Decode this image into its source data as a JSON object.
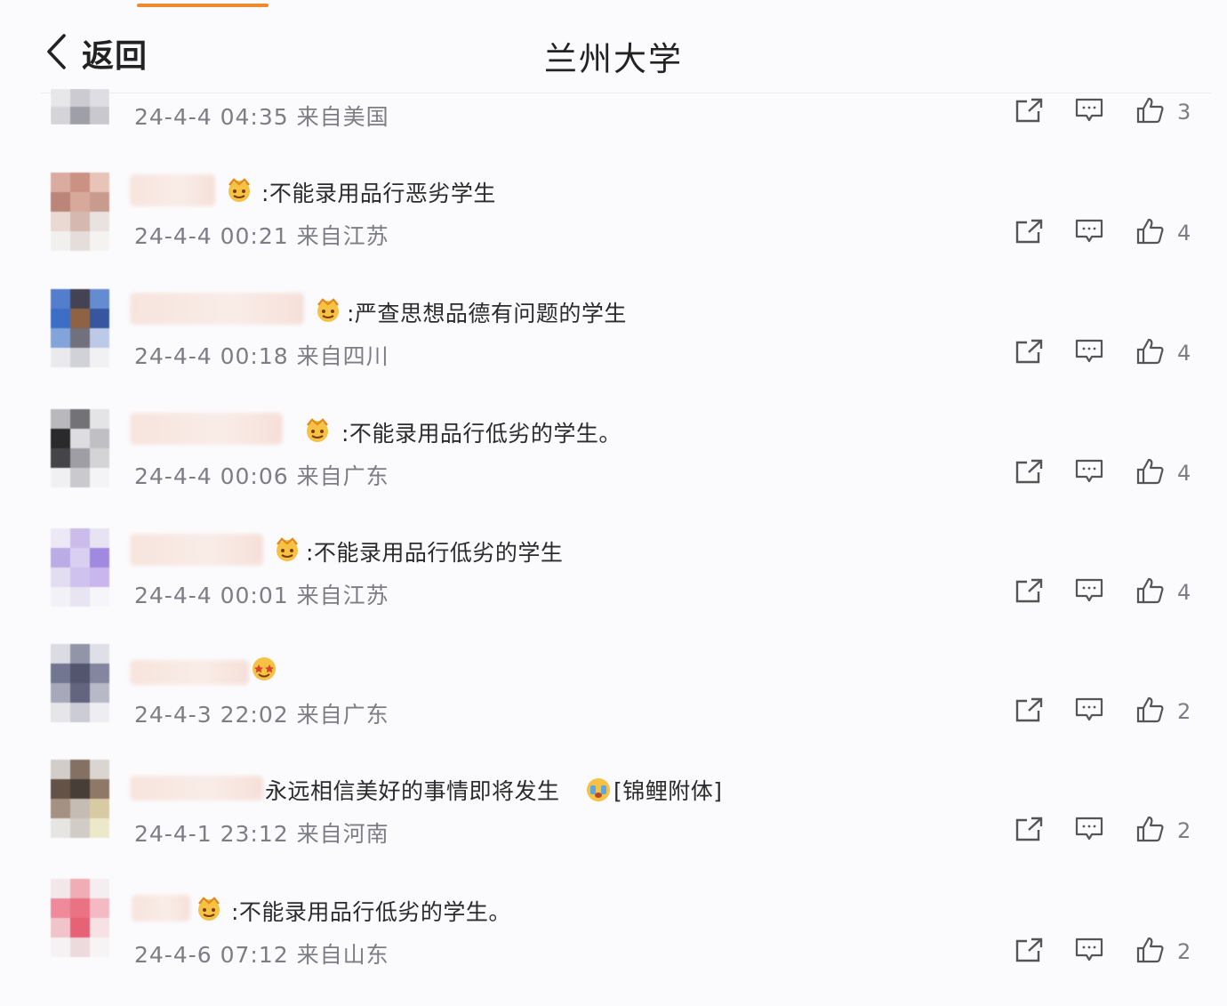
{
  "header": {
    "back_label": "返回",
    "title": "兰州大学"
  },
  "colors": {
    "accent": "#f08a2e",
    "meta_text": "#7d7d85"
  },
  "icons": {
    "back": "chevron-left-icon",
    "share": "share-icon",
    "comment": "comment-icon",
    "like": "thumbs-up-icon",
    "badge": "crown-emoji-icon"
  },
  "comments": [
    {
      "text": "",
      "meta": "24-4-4 04:35 来自美国",
      "likes": "3"
    },
    {
      "text": ":不能录用品行恶劣学生",
      "meta": "24-4-4 00:21 来自江苏",
      "likes": "4"
    },
    {
      "text": ":严查思想品德有问题的学生",
      "meta": "24-4-4 00:18 来自四川",
      "likes": "4"
    },
    {
      "text": ":不能录用品行低劣的学生。",
      "meta": "24-4-4 00:06 来自广东",
      "likes": "4"
    },
    {
      "text": ":不能录用品行低劣的学生",
      "meta": "24-4-4 00:01 来自江苏",
      "likes": "4"
    },
    {
      "text": "",
      "meta": "24-4-3 22:02 来自广东",
      "likes": "2"
    },
    {
      "text": "永远相信美好的事情即将发生",
      "text_suffix": "[锦鲤附体]",
      "meta": "24-4-1 23:12 来自河南",
      "likes": "2"
    },
    {
      "text": ":不能录用品行低劣的学生。",
      "meta": "24-4-6 07:12 来自山东",
      "likes": "2"
    }
  ]
}
